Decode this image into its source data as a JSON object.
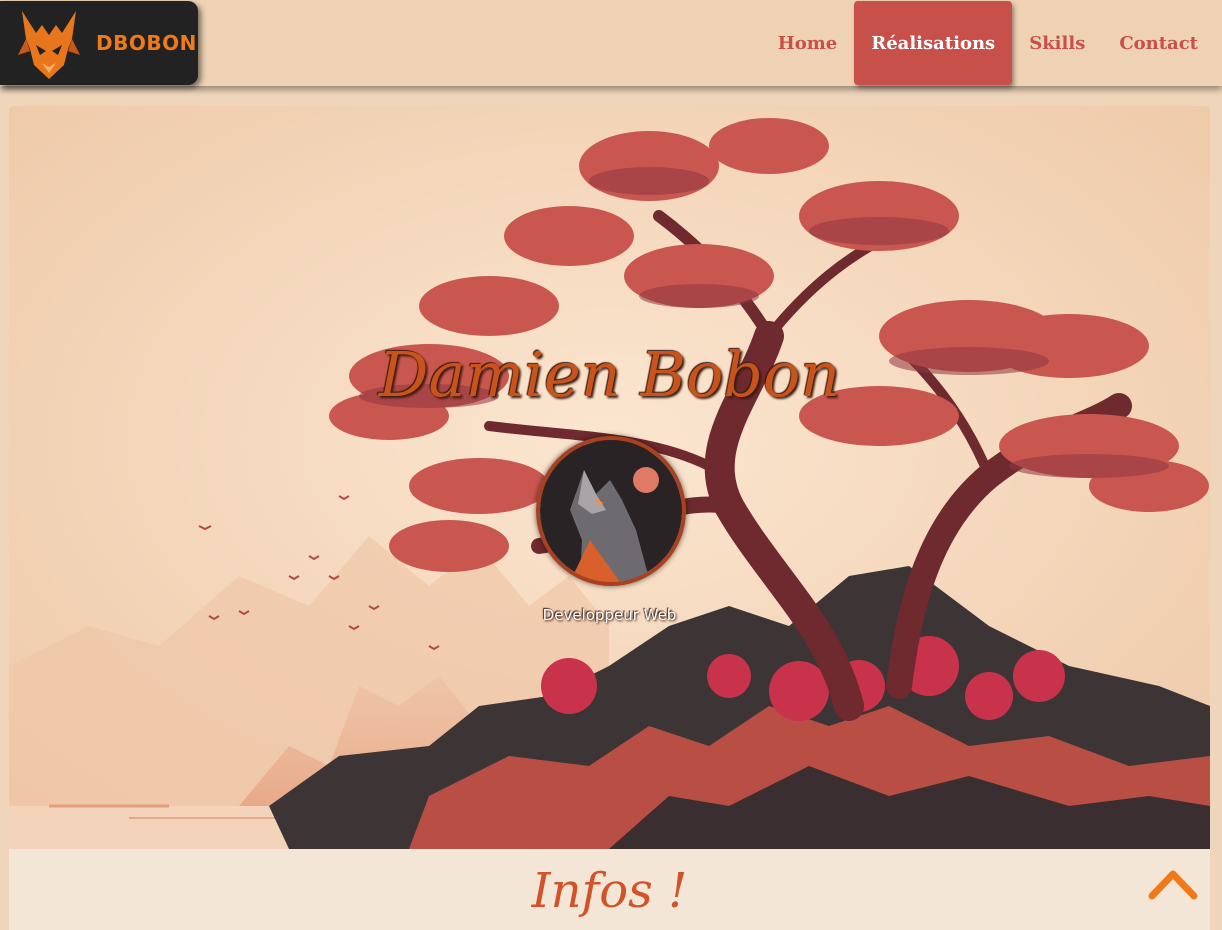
{
  "header": {
    "brand_name": "DBOBON",
    "logo_icon": "fox-logo-icon",
    "nav": [
      {
        "label": "Home",
        "active": false
      },
      {
        "label": "Réalisations",
        "active": true
      },
      {
        "label": "Skills",
        "active": false
      },
      {
        "label": "Contact",
        "active": false
      }
    ]
  },
  "hero": {
    "title": "Damien Bobon",
    "subtitle": "Developpeur Web",
    "avatar_icon": "wolf-avatar-icon",
    "background": "tree-landscape-illustration"
  },
  "infos": {
    "title": "Infos !"
  },
  "scroll_top_icon": "chevron-up-icon",
  "colors": {
    "accent": "#c7504b",
    "brand_orange": "#f07a1a",
    "header_bg": "#efd2b4",
    "infos_bg": "#f4e6d6"
  }
}
